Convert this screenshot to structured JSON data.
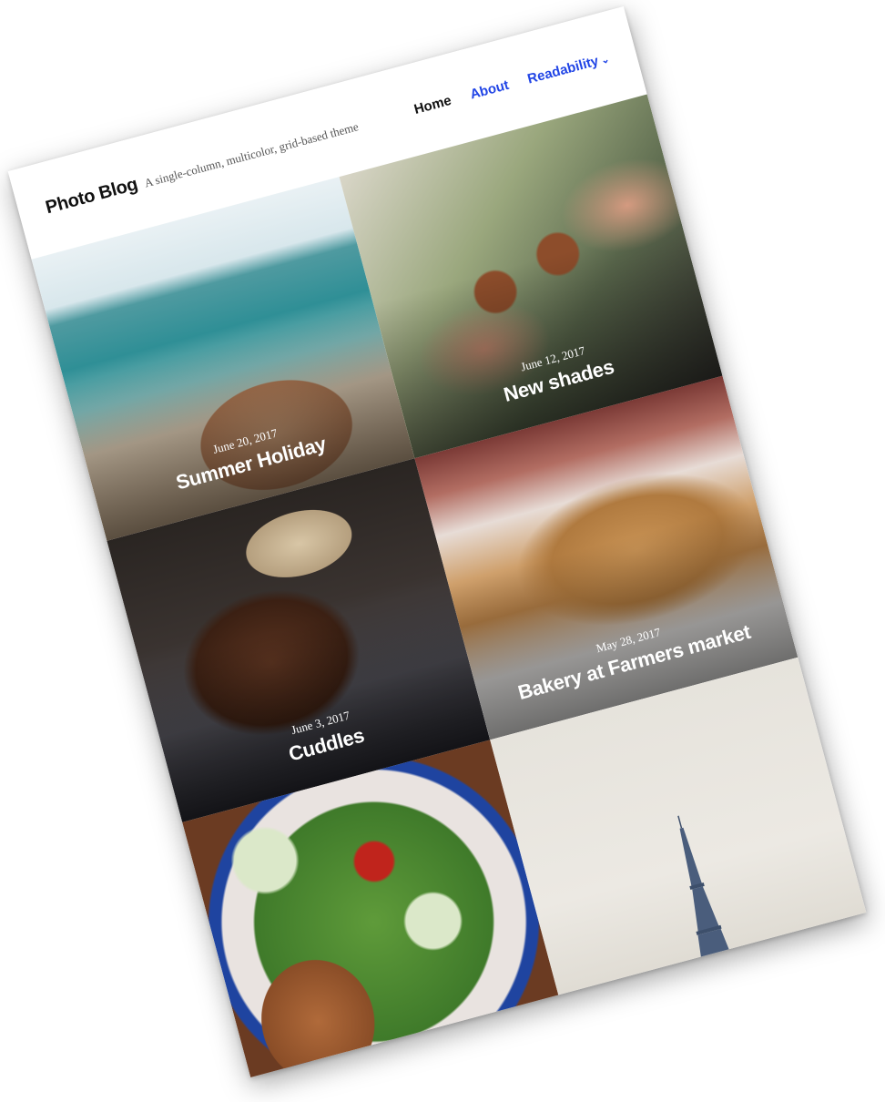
{
  "site": {
    "title": "Photo Blog",
    "description": "A single-column, multicolor, grid-based theme"
  },
  "nav": {
    "items": [
      {
        "label": "Home",
        "current": true
      },
      {
        "label": "About",
        "current": false
      },
      {
        "label": "Readability",
        "current": false,
        "has_submenu": true
      }
    ]
  },
  "posts": [
    {
      "date": "June 20, 2017",
      "title": "Summer Holiday",
      "image": "beach-feet"
    },
    {
      "date": "June 12, 2017",
      "title": "New shades",
      "image": "sunglasses"
    },
    {
      "date": "June 3, 2017",
      "title": "Cuddles",
      "image": "dogs"
    },
    {
      "date": "May 28, 2017",
      "title": "Bakery at Farmers market",
      "image": "bakery"
    },
    {
      "date": "",
      "title": "",
      "image": "salad"
    },
    {
      "date": "",
      "title": "",
      "image": "eiffel-tower"
    }
  ],
  "colors": {
    "link": "#2145e6",
    "text": "#111111"
  }
}
